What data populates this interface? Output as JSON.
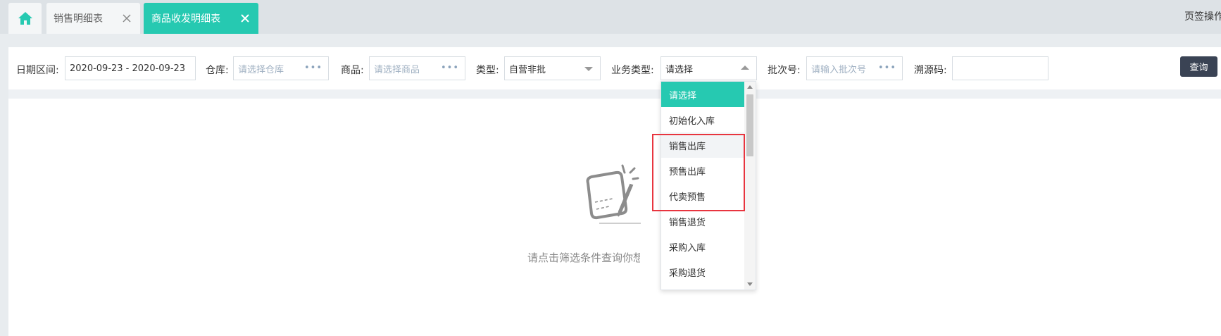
{
  "tabs": {
    "home_icon": "home-icon",
    "sales_detail": "销售明细表",
    "goods_detail": "商品收发明细表",
    "ops": "页签操作"
  },
  "filters": {
    "date_label": "日期区间:",
    "date_value": "2020-09-23 - 2020-09-23",
    "warehouse_label": "仓库:",
    "warehouse_placeholder": "请选择仓库",
    "goods_label": "商品:",
    "goods_placeholder": "请选择商品",
    "type_label": "类型:",
    "type_value": "自营非批",
    "biz_label": "业务类型:",
    "biz_value": "请选择",
    "batch_label": "批次号:",
    "batch_placeholder": "请输入批次号",
    "trace_label": "溯源码:",
    "trace_value": "",
    "query_button": "查询"
  },
  "empty_state": {
    "text": "请点击筛选条件查询你想"
  },
  "dropdown": {
    "items": [
      {
        "label": "请选择"
      },
      {
        "label": "初始化入库"
      },
      {
        "label": "销售出库"
      },
      {
        "label": "预售出库"
      },
      {
        "label": "代卖预售"
      },
      {
        "label": "销售退货"
      },
      {
        "label": "采购入库"
      },
      {
        "label": "采购退货"
      }
    ]
  },
  "colors": {
    "accent": "#26c9b1",
    "highlight": "#e8353f",
    "query_button": "#3a4354"
  }
}
